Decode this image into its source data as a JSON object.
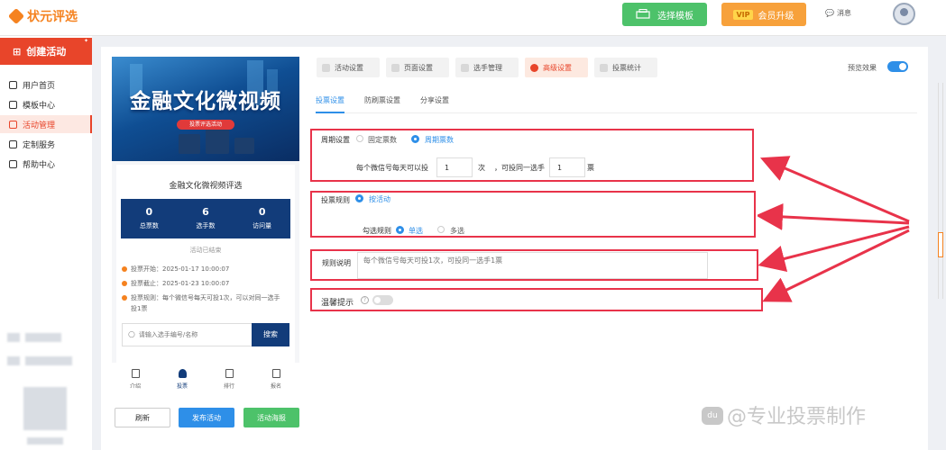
{
  "app": {
    "logo": "状元评选"
  },
  "header": {
    "template_btn": "选择模板",
    "vip_badge": "VIP",
    "vip_btn": "会员升级",
    "messages": "消息"
  },
  "sidebar": {
    "create": "创建活动",
    "items": [
      {
        "label": "用户首页"
      },
      {
        "label": "模板中心"
      },
      {
        "label": "活动管理"
      },
      {
        "label": "定制服务"
      },
      {
        "label": "帮助中心"
      }
    ]
  },
  "preview": {
    "banner_title": "金融文化微视频",
    "banner_sub": "投票评选活动",
    "title": "金融文化微视频评选",
    "stats": [
      {
        "value": "0",
        "label": "总票数"
      },
      {
        "value": "6",
        "label": "选手数"
      },
      {
        "value": "0",
        "label": "访问量"
      }
    ],
    "status": "活动已结束",
    "start": "投票开始：2025-01-17 10:00:07",
    "end": "投票截止：2025-01-23 10:00:07",
    "rule_line1": "投票规则：每个微信号每天可投1次，可以对同一选手",
    "rule_line2": "投1票",
    "search_placeholder": "请输入选手编号/名称",
    "search_btn": "搜索",
    "nav": [
      "介绍",
      "投票",
      "排行",
      "报名"
    ]
  },
  "actions": {
    "refresh": "刷新",
    "publish": "发布活动",
    "poster": "活动海报"
  },
  "tabs": [
    "活动设置",
    "页面设置",
    "选手管理",
    "高级设置",
    "投票统计"
  ],
  "preview_toggle": {
    "label": "预览效果",
    "on": true
  },
  "subtabs": [
    "投票设置",
    "防刷票设置",
    "分享设置"
  ],
  "form": {
    "cycle": {
      "label": "周期设置",
      "opt_fixed": "固定票数",
      "opt_cycle": "周期票数"
    },
    "daily": {
      "prefix": "每个微信号每天可以投",
      "count": "1",
      "unit": "次",
      "mid": "，可投同一选手",
      "same": "1",
      "unit2": "票"
    },
    "rule": {
      "label": "投票规则",
      "opt": "按活动"
    },
    "select": {
      "label": "勾选规则",
      "single": "单选",
      "multi": "多选"
    },
    "desc": {
      "label": "规则说明",
      "placeholder": "每个微信号每天可投1次，可投同一选手1票"
    },
    "tip": {
      "label": "温馨提示",
      "help": "?"
    }
  },
  "watermark": {
    "paw": "du",
    "text": "@专业投票制作"
  },
  "colors": {
    "accent": "#e8452a",
    "primary": "#2e8fe8",
    "highlight": "#e8334a",
    "navy": "#123c7a"
  }
}
